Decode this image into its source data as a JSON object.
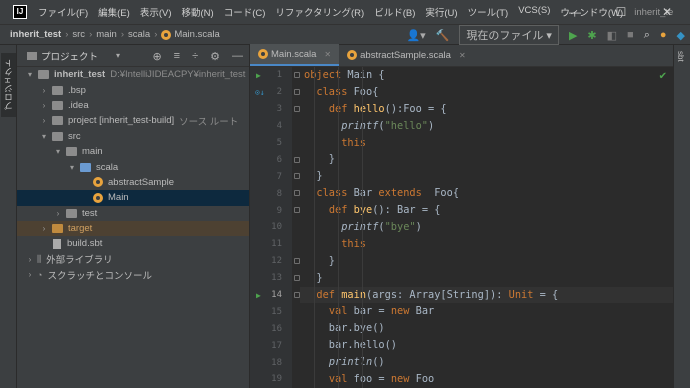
{
  "menu": {
    "logo": "IJ",
    "items": [
      "ファイル(F)",
      "編集(E)",
      "表示(V)",
      "移動(N)",
      "コード(C)",
      "リファクタリング(R)",
      "ビルド(B)",
      "実行(U)",
      "ツール(T)",
      "VCS(S)",
      "ウィンドウ(W)"
    ],
    "window_title": "inherit_te"
  },
  "window_controls": {
    "minimize": "—",
    "maximize": "☐",
    "close": "✕"
  },
  "breadcrumb": {
    "project": "inherit_test",
    "p1": "src",
    "p2": "main",
    "p3": "scala",
    "file": "Main.scala"
  },
  "toolbar": {
    "run_config": "現在のファイル ▾"
  },
  "project_panel": {
    "title": "プロジェクト",
    "strip_label": "プロジェクト",
    "tree": [
      {
        "label": "inherit_test",
        "extra": "D:¥IntelliJIDEACPY¥inherit_test",
        "depth": 0,
        "arrow": "▾",
        "icon": "folder",
        "bold": true
      },
      {
        "label": ".bsp",
        "depth": 1,
        "arrow": "›",
        "icon": "folder"
      },
      {
        "label": ".idea",
        "depth": 1,
        "arrow": "›",
        "icon": "folder"
      },
      {
        "label": "project [inherit_test-build]",
        "extra": "ソース ルート",
        "depth": 1,
        "arrow": "›",
        "icon": "folder"
      },
      {
        "label": "src",
        "depth": 1,
        "arrow": "▾",
        "icon": "folder"
      },
      {
        "label": "main",
        "depth": 2,
        "arrow": "▾",
        "icon": "folder"
      },
      {
        "label": "scala",
        "depth": 3,
        "arrow": "▾",
        "icon": "folder-blue"
      },
      {
        "label": "abstractSample",
        "depth": 4,
        "arrow": "",
        "icon": "object"
      },
      {
        "label": "Main",
        "depth": 4,
        "arrow": "",
        "icon": "object",
        "selected": true
      },
      {
        "label": "test",
        "depth": 2,
        "arrow": "›",
        "icon": "folder"
      },
      {
        "label": "target",
        "depth": 1,
        "arrow": "›",
        "icon": "folder-orange",
        "highlight": true
      },
      {
        "label": "build.sbt",
        "depth": 1,
        "arrow": "",
        "icon": "file"
      },
      {
        "label": "外部ライブラリ",
        "depth": 0,
        "arrow": "›",
        "icon": "library"
      },
      {
        "label": "スクラッチとコンソール",
        "depth": 0,
        "arrow": "›",
        "icon": "scratch"
      }
    ]
  },
  "editor": {
    "tabs": [
      {
        "label": "Main.scala",
        "active": true
      },
      {
        "label": "abstractSample.scala",
        "active": false
      }
    ],
    "right_strip_label": "sbt",
    "line_numbers": [
      "1",
      "2",
      "3",
      "4",
      "5",
      "6",
      "7",
      "8",
      "9",
      "10",
      "11",
      "12",
      "13",
      "14",
      "15",
      "16",
      "17",
      "18",
      "19"
    ],
    "code": [
      [
        {
          "t": "object ",
          "c": "kw"
        },
        {
          "t": "Main {"
        }
      ],
      [
        {
          "t": "  "
        },
        {
          "t": "class ",
          "c": "kw"
        },
        {
          "t": "Foo{"
        }
      ],
      [
        {
          "t": "    "
        },
        {
          "t": "def ",
          "c": "kw"
        },
        {
          "t": "hello",
          "c": "fn"
        },
        {
          "t": "():Foo = {"
        }
      ],
      [
        {
          "t": "      "
        },
        {
          "t": "printf",
          "c": "it"
        },
        {
          "t": "("
        },
        {
          "t": "\"hello\"",
          "c": "str"
        },
        {
          "t": ")"
        }
      ],
      [
        {
          "t": "      "
        },
        {
          "t": "this",
          "c": "kw"
        }
      ],
      [
        {
          "t": "    }"
        }
      ],
      [
        {
          "t": "  }"
        }
      ],
      [
        {
          "t": "  "
        },
        {
          "t": "class ",
          "c": "kw"
        },
        {
          "t": "Bar "
        },
        {
          "t": "extends ",
          "c": "kw"
        },
        {
          "t": " Foo{"
        }
      ],
      [
        {
          "t": "    "
        },
        {
          "t": "def ",
          "c": "kw"
        },
        {
          "t": "bye",
          "c": "fn"
        },
        {
          "t": "(): Bar = {"
        }
      ],
      [
        {
          "t": "      "
        },
        {
          "t": "printf",
          "c": "it"
        },
        {
          "t": "("
        },
        {
          "t": "\"bye\"",
          "c": "str"
        },
        {
          "t": ")"
        }
      ],
      [
        {
          "t": "      "
        },
        {
          "t": "this",
          "c": "kw"
        }
      ],
      [
        {
          "t": "    }"
        }
      ],
      [
        {
          "t": "  }"
        }
      ],
      [
        {
          "t": "  "
        },
        {
          "t": "def ",
          "c": "kw"
        },
        {
          "t": "main",
          "c": "fn"
        },
        {
          "t": "(args: Array[String]): "
        },
        {
          "t": "Unit",
          "c": "kw"
        },
        {
          "t": " = {"
        }
      ],
      [
        {
          "t": "    "
        },
        {
          "t": "val ",
          "c": "kw"
        },
        {
          "t": "bar = "
        },
        {
          "t": "new ",
          "c": "kw"
        },
        {
          "t": "Bar"
        }
      ],
      [
        {
          "t": "    bar.bye()"
        }
      ],
      [
        {
          "t": "    bar.hello()"
        }
      ],
      [
        {
          "t": "    "
        },
        {
          "t": "println",
          "c": "it"
        },
        {
          "t": "()"
        }
      ],
      [
        {
          "t": "    "
        },
        {
          "t": "val ",
          "c": "kw"
        },
        {
          "t": "foo = "
        },
        {
          "t": "new ",
          "c": "kw"
        },
        {
          "t": "Foo"
        }
      ]
    ]
  }
}
